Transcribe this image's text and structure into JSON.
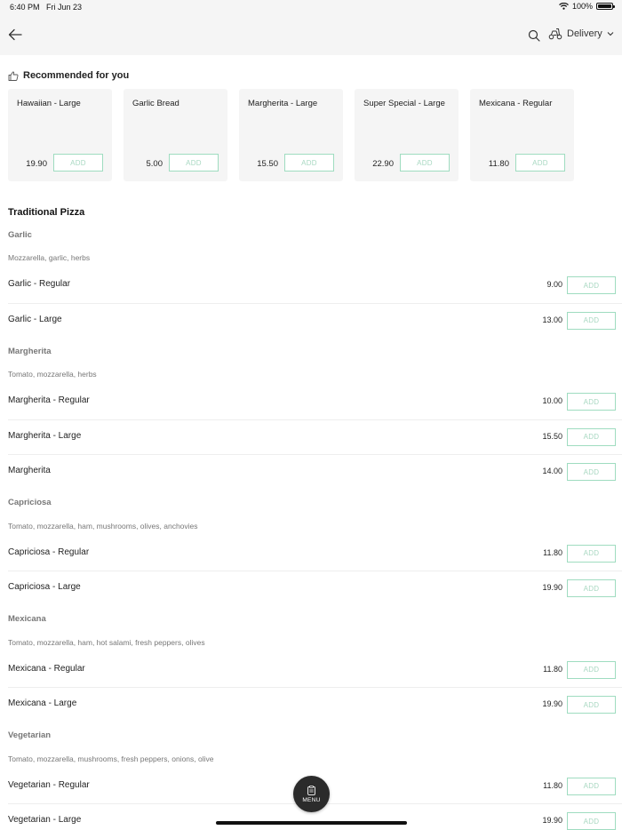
{
  "status": {
    "time": "6:40 PM",
    "date": "Fri Jun 23",
    "battery": "100%"
  },
  "header": {
    "delivery_label": "Delivery"
  },
  "recommended": {
    "title": "Recommended for you",
    "items": [
      {
        "name": "Hawaiian - Large",
        "price": "19.90",
        "add": "ADD"
      },
      {
        "name": "Garlic Bread",
        "price": "5.00",
        "add": "ADD"
      },
      {
        "name": "Margherita - Large",
        "price": "15.50",
        "add": "ADD"
      },
      {
        "name": "Super Special - Large",
        "price": "22.90",
        "add": "ADD"
      },
      {
        "name": "Mexicana - Regular",
        "price": "11.80",
        "add": "ADD"
      }
    ]
  },
  "section": {
    "title": "Traditional Pizza"
  },
  "groups": [
    {
      "name": "Garlic",
      "desc": "Mozzarella, garlic, herbs",
      "items": [
        {
          "name": "Garlic - Regular",
          "price": "9.00",
          "add": "ADD"
        },
        {
          "name": "Garlic - Large",
          "price": "13.00",
          "add": "ADD"
        }
      ]
    },
    {
      "name": "Margherita",
      "desc": "Tomato, mozzarella, herbs",
      "items": [
        {
          "name": "Margherita - Regular",
          "price": "10.00",
          "add": "ADD"
        },
        {
          "name": "Margherita - Large",
          "price": "15.50",
          "add": "ADD"
        },
        {
          "name": "Margherita",
          "price": "14.00",
          "add": "ADD"
        }
      ]
    },
    {
      "name": "Capriciosa",
      "desc": "Tomato, mozzarella, ham, mushrooms, olives, anchovies",
      "items": [
        {
          "name": "Capriciosa - Regular",
          "price": "11.80",
          "add": "ADD"
        },
        {
          "name": "Capriciosa - Large",
          "price": "19.90",
          "add": "ADD"
        }
      ]
    },
    {
      "name": "Mexicana",
      "desc": "Tomato, mozzarella, ham, hot salami, fresh peppers, olives",
      "items": [
        {
          "name": "Mexicana - Regular",
          "price": "11.80",
          "add": "ADD"
        },
        {
          "name": "Mexicana - Large",
          "price": "19.90",
          "add": "ADD"
        }
      ]
    },
    {
      "name": "Vegetarian",
      "desc": "Tomato, mozzarella, mushrooms, fresh peppers, onions, olive",
      "items": [
        {
          "name": "Vegetarian - Regular",
          "price": "11.80",
          "add": "ADD"
        },
        {
          "name": "Vegetarian - Large",
          "price": "19.90",
          "add": "ADD"
        }
      ]
    }
  ],
  "fab": {
    "label": "MENU"
  },
  "colors": {
    "accent": "#9fdcc0",
    "background": "#f5f5f5",
    "fab": "#2b2b2b"
  },
  "icons": [
    "back-arrow-icon",
    "search-icon",
    "scooter-icon",
    "chevron-down-icon",
    "thumbs-up-icon",
    "menu-clipboard-icon",
    "wifi-icon",
    "battery-icon"
  ]
}
